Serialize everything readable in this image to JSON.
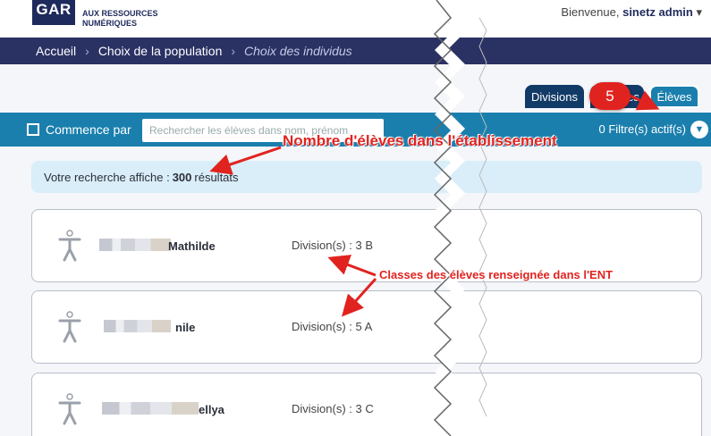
{
  "header": {
    "logo_abbr": "GAR",
    "logo_line1": "AUX RESSOURCES",
    "logo_line2": "NUMÉRIQUES",
    "welcome_prefix": "Bienvenue,",
    "welcome_user": "sinetz admin",
    "welcome_caret": "▾"
  },
  "breadcrumb": {
    "items": [
      "Accueil",
      "Choix de la population",
      "Choix des individus"
    ],
    "separator": "›"
  },
  "tabs": [
    {
      "label": "Divisions"
    },
    {
      "label": "Groupes"
    },
    {
      "label": "Élèves",
      "active": true
    }
  ],
  "filter": {
    "checkbox_label": "Commence par",
    "search_placeholder": "Rechercher les élèves dans nom, prénom",
    "active_filters": "0 Filtre(s) actif(s)",
    "toggle_icon": "chevron-down-icon",
    "toggle_glyph": "▼"
  },
  "results": {
    "prefix": "Votre recherche affiche :",
    "count": "300",
    "suffix": "résultats"
  },
  "students": [
    {
      "name": "Mathilde",
      "division": "Division(s) : 3 B"
    },
    {
      "name": "nile",
      "division": "Division(s) : 5 A"
    },
    {
      "name": "ellya",
      "division": "Division(s) : 3 C"
    }
  ],
  "annotations": {
    "step_number": "5",
    "total_label": "Nombre d'élèves dans l'établissement",
    "class_label": "Classes des élèves renseignée dans l'ENT"
  },
  "colors": {
    "navy": "#2a3163",
    "teal": "#1a7fad",
    "annotation_red": "#e1231f"
  }
}
